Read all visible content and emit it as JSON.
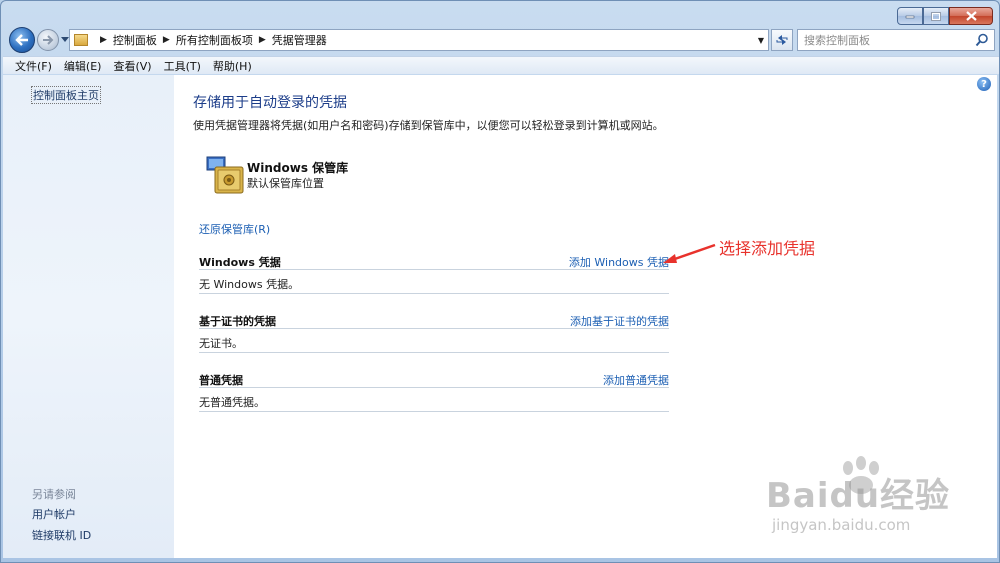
{
  "window": {
    "caption": {
      "minimize": "minimize-icon",
      "maximize": "maximize-icon",
      "close": "close-icon"
    }
  },
  "nav": {
    "breadcrumbs": [
      "控制面板",
      "所有控制面板项",
      "凭据管理器"
    ],
    "search_placeholder": "搜索控制面板"
  },
  "menu": [
    "文件(F)",
    "编辑(E)",
    "查看(V)",
    "工具(T)",
    "帮助(H)"
  ],
  "sidebar": {
    "home": "控制面板主页",
    "see_also": "另请参阅",
    "links": [
      "用户帐户",
      "链接联机 ID"
    ]
  },
  "main": {
    "title": "存储用于自动登录的凭据",
    "description": "使用凭据管理器将凭据(如用户名和密码)存储到保管库中，以便您可以轻松登录到计算机或网站。",
    "vault": {
      "name": "Windows 保管库",
      "subtitle": "默认保管库位置"
    },
    "restore_link": "还原保管库(R)",
    "sections": [
      {
        "title": "Windows 凭据",
        "add": "添加 Windows 凭据",
        "empty": "无 Windows 凭据。"
      },
      {
        "title": "基于证书的凭据",
        "add": "添加基于证书的凭据",
        "empty": "无证书。"
      },
      {
        "title": "普通凭据",
        "add": "添加普通凭据",
        "empty": "无普通凭据。"
      }
    ]
  },
  "annotation": {
    "text": "选择添加凭据",
    "color": "#e8322c"
  },
  "watermark": {
    "logo": "Baidu经验",
    "url": "jingyan.baidu.com"
  }
}
